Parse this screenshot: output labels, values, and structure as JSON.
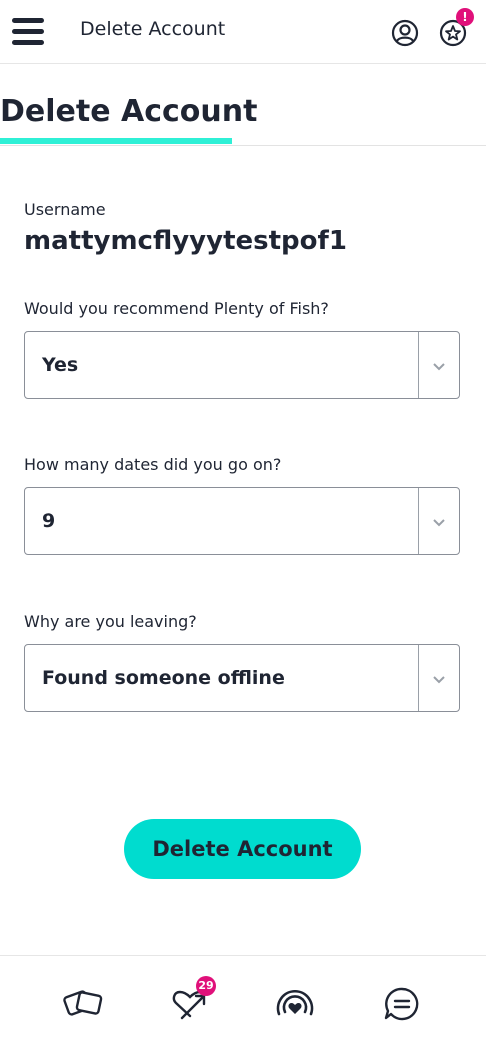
{
  "header": {
    "title": "Delete Account",
    "notification_badge": "!"
  },
  "page": {
    "heading": "Delete Account"
  },
  "form": {
    "username_label": "Username",
    "username_value": "mattymcflyyytestpof1",
    "recommend_label": "Would you recommend Plenty of Fish?",
    "recommend_value": "Yes",
    "dates_label": "How many dates did you go on?",
    "dates_value": "9",
    "reason_label": "Why are you leaving?",
    "reason_value": "Found someone offline"
  },
  "actions": {
    "delete_label": "Delete Account"
  },
  "bottom_nav": {
    "items": [
      {
        "icon": "cards-icon"
      },
      {
        "icon": "interested-arrow-icon",
        "badge": "29"
      },
      {
        "icon": "live-broadcast-icon"
      },
      {
        "icon": "chat-icon"
      }
    ]
  },
  "colors": {
    "accent": "#00dccf",
    "underline": "#2ff0d6",
    "badge": "#e0107a",
    "text": "#1f2533"
  }
}
